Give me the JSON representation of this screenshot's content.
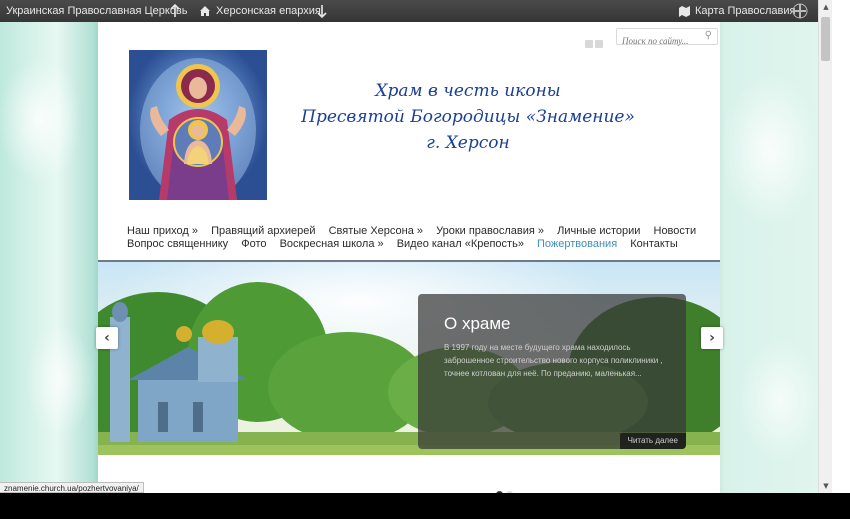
{
  "topbar": {
    "left_item": "Украинская Православная Церковь",
    "up_icon": "arrow-up-icon",
    "home_icon": "home-icon",
    "diocese": "Херсонская епархия",
    "down_icon": "arrow-down-icon",
    "map_icon": "map-icon",
    "map_label": "Карта Православия",
    "cross_icon": "orthodox-cross-icon"
  },
  "header": {
    "search_placeholder": "Поиск по сайту...",
    "title_line1": "Храм в честь иконы",
    "title_line2": "Пресвятой Богородицы «Знамение»",
    "title_line3": "г. Херсон"
  },
  "nav": {
    "row1": [
      "Наш приход »",
      "Правящий архиерей",
      "Святые Херсона »",
      "Уроки православия »",
      "Личные истории",
      "Новости"
    ],
    "row2": [
      "Вопрос священнику",
      "Фото",
      "Воскресная школа »",
      "Видео канал «Крепость»",
      "Пожертвования",
      "Контакты"
    ],
    "active_item": "Пожертвования"
  },
  "slider": {
    "title": "О храме",
    "text": "В 1997 году на месте будущего храма находилось заброшенное строительство нового корпуса поликлиники , точнее котлован для неё. По преданию, маленькая...",
    "more_label": "Читать далее",
    "prev_label": "‹",
    "next_label": "›",
    "slide_count": 2,
    "active_slide": 1
  },
  "status_bar": {
    "url": "znamenie.church.ua/pozhertvovaniya/"
  },
  "colors": {
    "title_blue": "#1b3f95",
    "active_link": "#3f8fb8",
    "topbar": "#3d3d3d"
  }
}
